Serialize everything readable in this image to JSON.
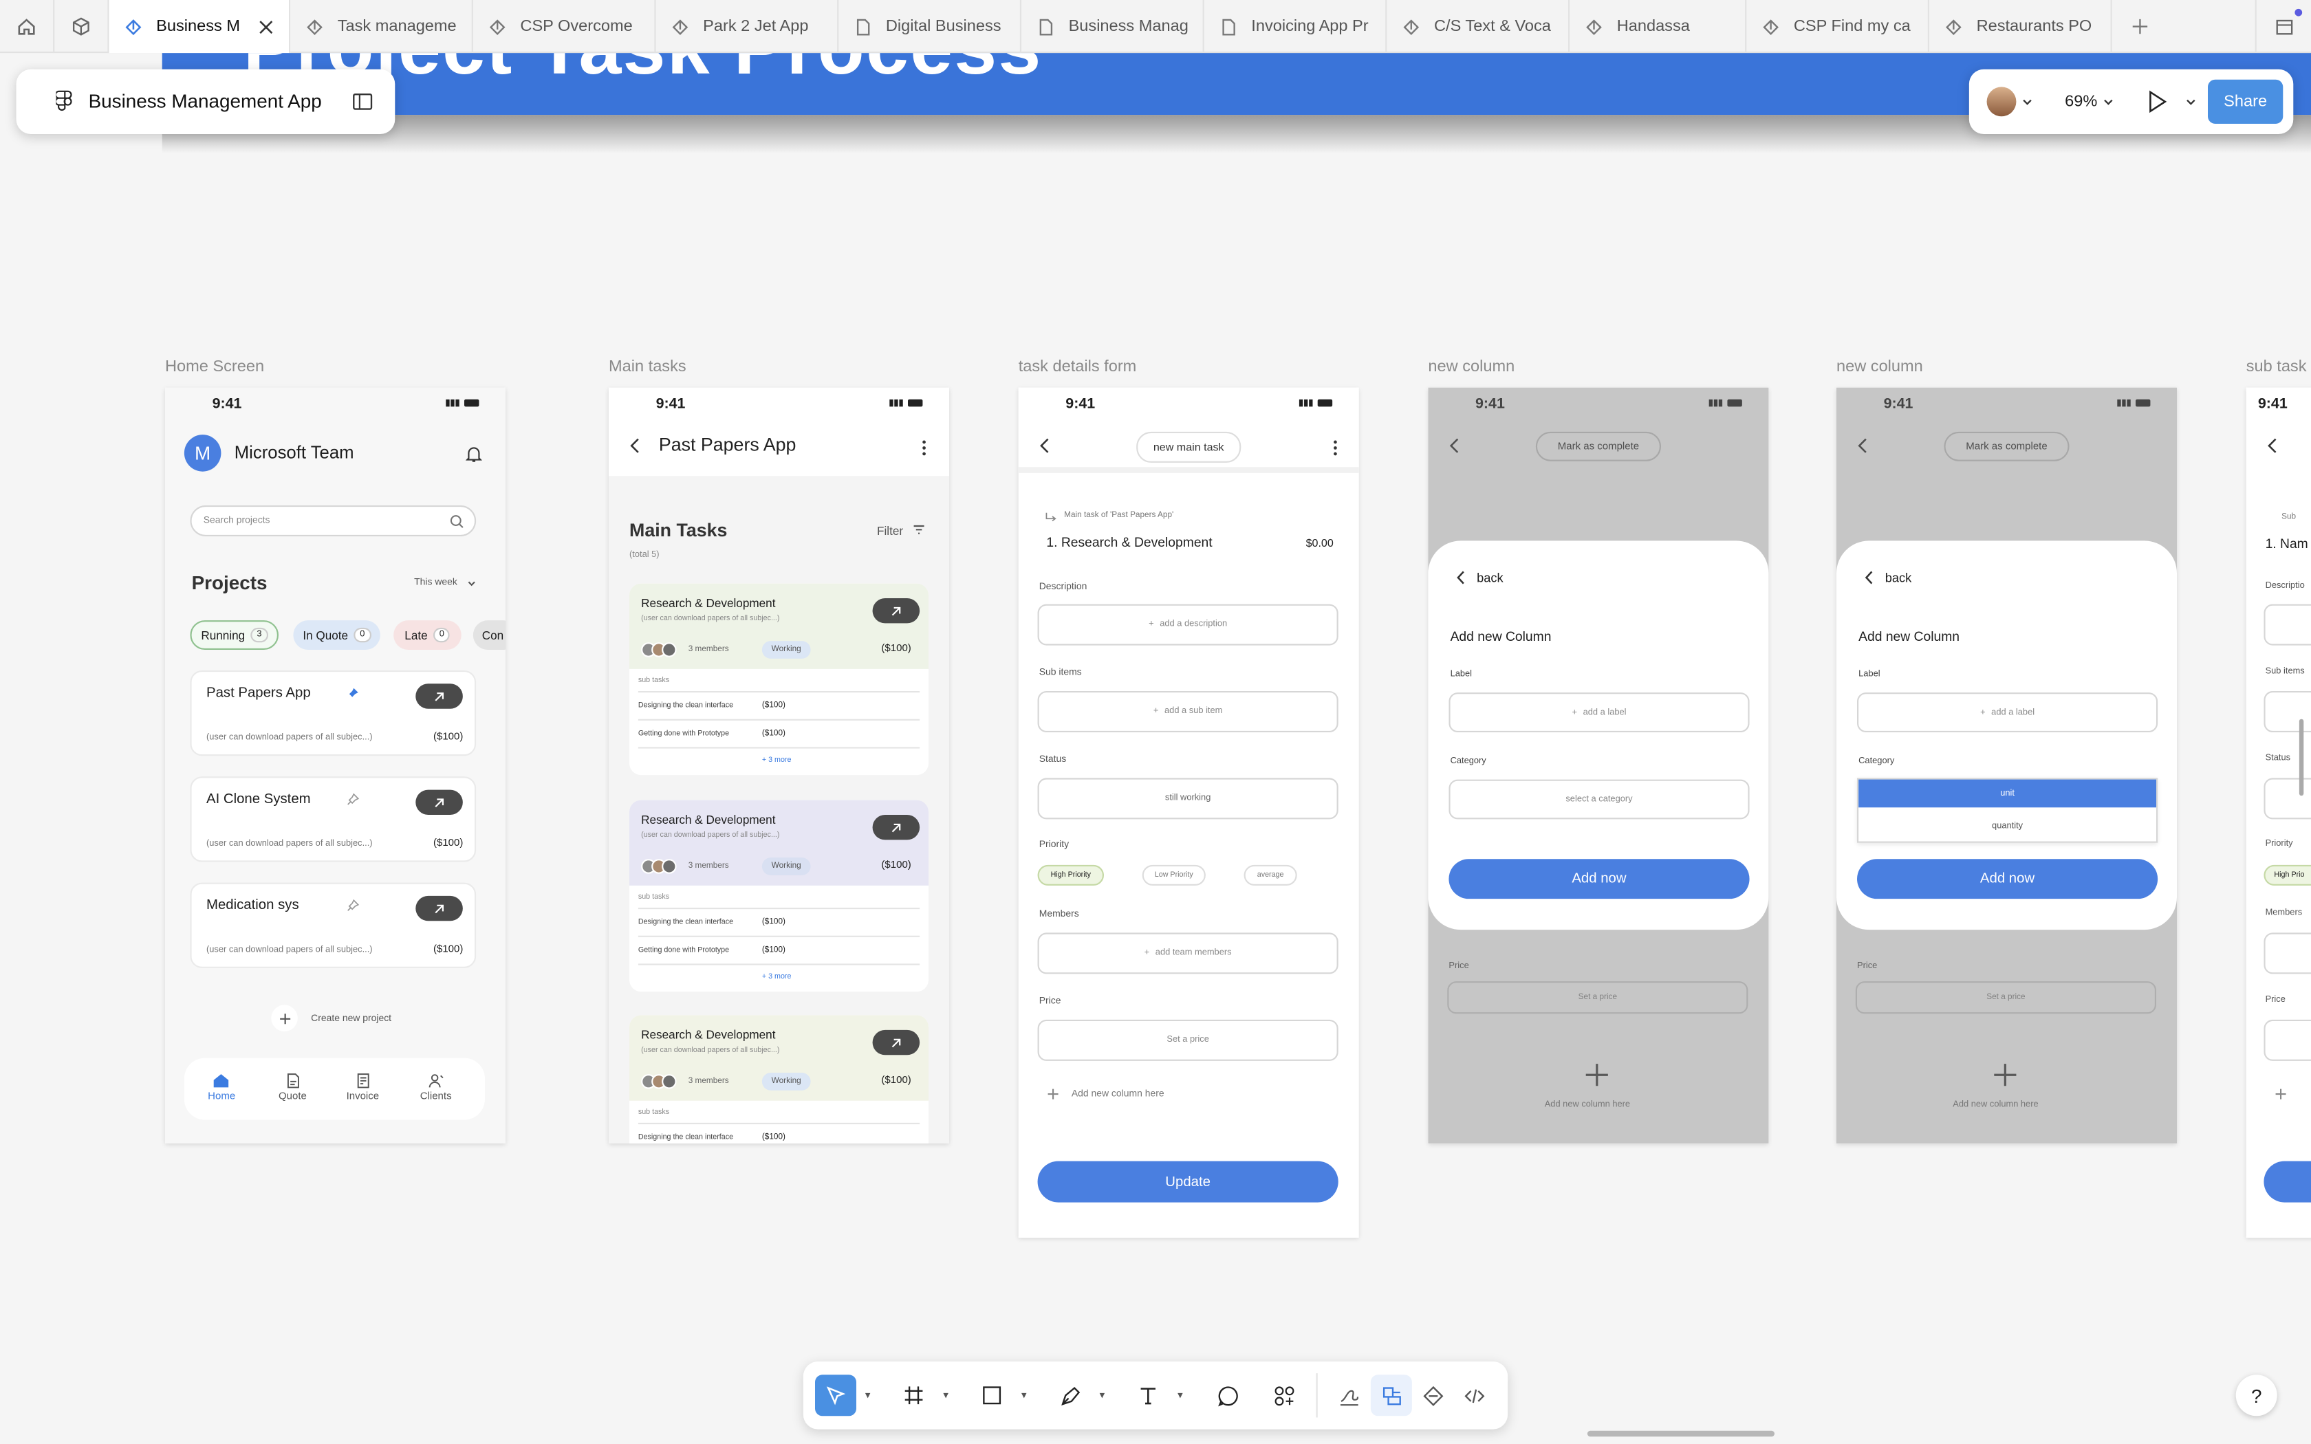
{
  "tabs": [
    {
      "label": "Business M",
      "active": true
    },
    {
      "label": "Task manageme"
    },
    {
      "label": "CSP Overcome"
    },
    {
      "label": "Park 2 Jet App"
    },
    {
      "label": "Digital Business"
    },
    {
      "label": "Business Manag"
    },
    {
      "label": "Invoicing App Pr"
    },
    {
      "label": "C/S Text & Voca"
    },
    {
      "label": "Handassa"
    },
    {
      "label": "CSP Find my ca"
    },
    {
      "label": "Restaurants PO"
    }
  ],
  "file": {
    "name": "Business Management App"
  },
  "banner": {
    "text": "Project Task Process"
  },
  "right_panel": {
    "zoom": "69%",
    "share_label": "Share"
  },
  "frame_labels": [
    "Home Screen",
    "Main tasks",
    "task details form",
    "new column",
    "new column",
    "sub task"
  ],
  "status_time": "9:41",
  "home": {
    "avatar_letter": "M",
    "team": "Microsoft Team",
    "search_placeholder": "Search projects",
    "projects_title": "Projects",
    "period": "This week",
    "filters": [
      {
        "label": "Running",
        "count": "3"
      },
      {
        "label": "In Quote",
        "count": "0"
      },
      {
        "label": "Late",
        "count": "0"
      },
      {
        "label": "Con"
      }
    ],
    "projects": [
      {
        "name": "Past Papers App",
        "desc": "(user can download papers of all subjec...)",
        "price": "($100)"
      },
      {
        "name": "AI Clone System",
        "desc": "(user can download papers of all subjec...)",
        "price": "($100)"
      },
      {
        "name": "Medication sys",
        "desc": "(user can download papers of all subjec...)",
        "price": "($100)"
      }
    ],
    "create_label": "Create new project",
    "nav": [
      "Home",
      "Quote",
      "Invoice",
      "Clients"
    ]
  },
  "main": {
    "title": "Past Papers App",
    "section": "Main Tasks",
    "total": "(total 5)",
    "filter": "Filter",
    "tasks": [
      {
        "title": "Research & Development",
        "desc": "(user can download papers of all subjec...)",
        "members": "3 members",
        "status": "Working",
        "price": "($100)",
        "subtasks_label": "sub tasks",
        "subtasks": [
          {
            "name": "Designing the clean interface",
            "price": "($100)"
          },
          {
            "name": "Getting done with Prototype",
            "price": "($100)"
          }
        ],
        "more": "+ 3 more"
      },
      {
        "title": "Research & Development",
        "desc": "(user can download papers of all subjec...)",
        "members": "3 members",
        "status": "Working",
        "price": "($100)",
        "subtasks_label": "sub tasks",
        "subtasks": [
          {
            "name": "Designing the clean interface",
            "price": "($100)"
          },
          {
            "name": "Getting done with Prototype",
            "price": "($100)"
          }
        ],
        "more": "+ 3 more"
      },
      {
        "title": "Research & Development",
        "desc": "(user can download papers of all subjec...)",
        "members": "3 members",
        "status": "Working",
        "price": "($100)",
        "subtasks_label": "sub tasks",
        "subtasks": [
          {
            "name": "Designing the clean interface",
            "price": "($100)"
          }
        ]
      }
    ]
  },
  "form": {
    "pill": "new main task",
    "parent": "Main task of 'Past Papers App'",
    "task": "1. Research & Development",
    "price_value": "$0.00",
    "description_label": "Description",
    "description_placeholder": "add a description",
    "subitems_label": "Sub items",
    "subitems_placeholder": "add a sub item",
    "status_label": "Status",
    "status_value": "still working",
    "priority_label": "Priority",
    "priorities": [
      "High Priority",
      "Low Priority",
      "average"
    ],
    "members_label": "Members",
    "members_placeholder": "add team members",
    "price_label": "Price",
    "price_placeholder": "Set a price",
    "add_column": "Add new column here",
    "update": "Update"
  },
  "modal1": {
    "pill": "Mark as complete",
    "back": "back",
    "title": "Add new Column",
    "label_label": "Label",
    "label_placeholder": "add a label",
    "category_label": "Category",
    "category_placeholder": "select a category",
    "add_now": "Add now",
    "price_label": "Price",
    "price_placeholder": "Set a price",
    "add_column": "Add new column here"
  },
  "modal2": {
    "pill": "Mark as complete",
    "back": "back",
    "title": "Add new Column",
    "label_label": "Label",
    "label_placeholder": "add a label",
    "category_label": "Category",
    "options": [
      "unit",
      "quantity"
    ],
    "add_now": "Add now",
    "price_label": "Price",
    "price_placeholder": "Set a price",
    "add_column": "Add new column here"
  },
  "partial": {
    "sub": "Sub",
    "name": "1. Nam",
    "description": "Descriptio",
    "subitems": "Sub items",
    "status": "Status",
    "priority": "Priority",
    "high": "High Prio",
    "members": "Members",
    "price": "Price"
  },
  "colors": {
    "accent": "#4a7fe0",
    "banner": "#3a74d9",
    "share": "#4a90e2"
  }
}
